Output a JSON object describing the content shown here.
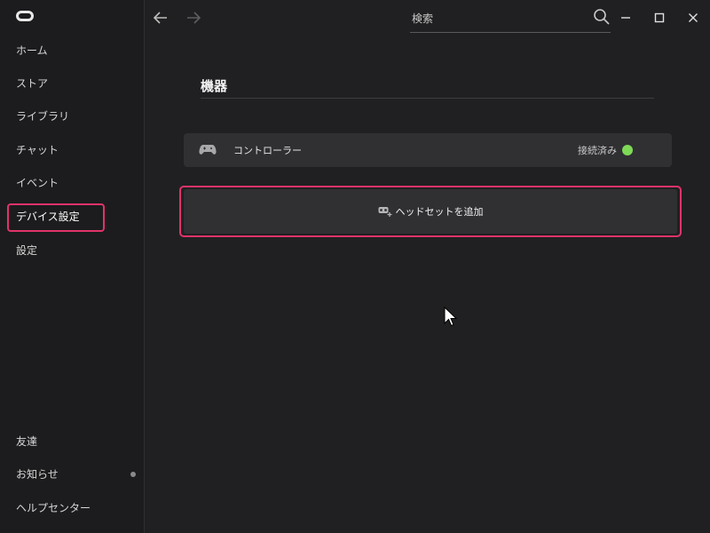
{
  "sidebar": {
    "items": [
      {
        "label": "ホーム"
      },
      {
        "label": "ストア"
      },
      {
        "label": "ライブラリ"
      },
      {
        "label": "チャット"
      },
      {
        "label": "イベント"
      },
      {
        "label": "デバイス設定"
      },
      {
        "label": "設定"
      }
    ],
    "bottom_items": [
      {
        "label": "友達"
      },
      {
        "label": "お知らせ"
      },
      {
        "label": "ヘルプセンター"
      }
    ],
    "active_item": "デバイス設定"
  },
  "topbar": {
    "search_placeholder": "検索"
  },
  "main": {
    "title": "機器",
    "devices": [
      {
        "name": "コントローラー",
        "status": "接続済み",
        "status_color": "#7ed957"
      }
    ],
    "add_button_label": "ヘッドセットを追加"
  },
  "colors": {
    "highlight": "#e0336a",
    "connected": "#7ed957"
  }
}
